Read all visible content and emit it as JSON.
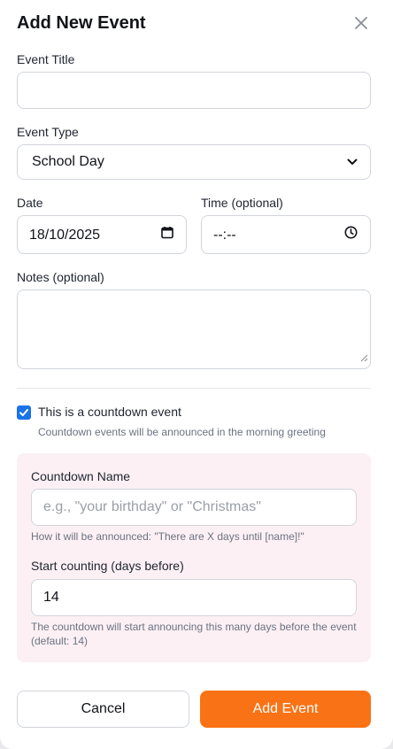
{
  "dialog": {
    "title": "Add New Event",
    "close_icon": "close-icon"
  },
  "form": {
    "event_title": {
      "label": "Event Title",
      "value": "",
      "placeholder": ""
    },
    "event_type": {
      "label": "Event Type",
      "value": "School Day",
      "icon": "chevron-down-icon"
    },
    "date": {
      "label": "Date",
      "value": "18/10/2025",
      "icon": "calendar-icon"
    },
    "time": {
      "label": "Time (optional)",
      "value": "--:--",
      "icon": "clock-icon"
    },
    "notes": {
      "label": "Notes (optional)",
      "value": ""
    }
  },
  "countdown": {
    "checked": true,
    "checkbox_label": "This is a countdown event",
    "checkbox_help": "Countdown events will be announced in the morning greeting",
    "name": {
      "label": "Countdown Name",
      "placeholder": "e.g., \"your birthday\" or \"Christmas\"",
      "help": "How it will be announced: \"There are X days until [name]!\""
    },
    "start": {
      "label": "Start counting (days before)",
      "value": "14",
      "help": "The countdown will start announcing this many days before the event (default: 14)"
    }
  },
  "actions": {
    "cancel_label": "Cancel",
    "add_label": "Add Event"
  },
  "colors": {
    "accent": "#f97316",
    "checkbox": "#1a73e8",
    "countdown_bg": "#fcf0f4"
  }
}
